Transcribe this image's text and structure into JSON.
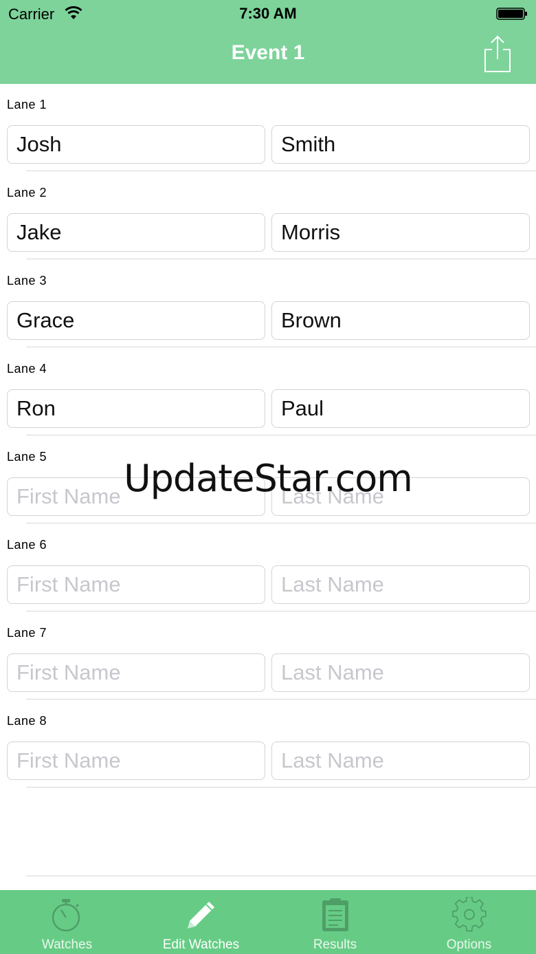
{
  "status": {
    "carrier": "Carrier",
    "time": "7:30 AM",
    "icons": [
      "wifi-icon",
      "battery-icon"
    ]
  },
  "nav": {
    "title": "Event 1",
    "share_icon": "share-icon"
  },
  "lanes": [
    {
      "label": "Lane  1",
      "first": "Josh",
      "last": "Smith"
    },
    {
      "label": "Lane  2",
      "first": "Jake",
      "last": "Morris"
    },
    {
      "label": "Lane  3",
      "first": "Grace",
      "last": "Brown"
    },
    {
      "label": "Lane  4",
      "first": "Ron",
      "last": "Paul"
    },
    {
      "label": "Lane  5",
      "first": "",
      "last": ""
    },
    {
      "label": "Lane  6",
      "first": "",
      "last": ""
    },
    {
      "label": "Lane  7",
      "first": "",
      "last": ""
    },
    {
      "label": "Lane  8",
      "first": "",
      "last": ""
    }
  ],
  "placeholders": {
    "first": "First Name",
    "last": "Last Name"
  },
  "watermark": "UpdateStar.com",
  "tabs": [
    {
      "label": "Watches",
      "icon": "stopwatch-icon"
    },
    {
      "label": "Edit Watches",
      "icon": "pencil-icon"
    },
    {
      "label": "Results",
      "icon": "clipboard-icon"
    },
    {
      "label": "Options",
      "icon": "gear-icon"
    }
  ],
  "colors": {
    "bar": "#7dd39a",
    "tabbar": "#66cc85",
    "tab_icon": "#4f9e68",
    "active_tab_icon": "#ffffff"
  }
}
